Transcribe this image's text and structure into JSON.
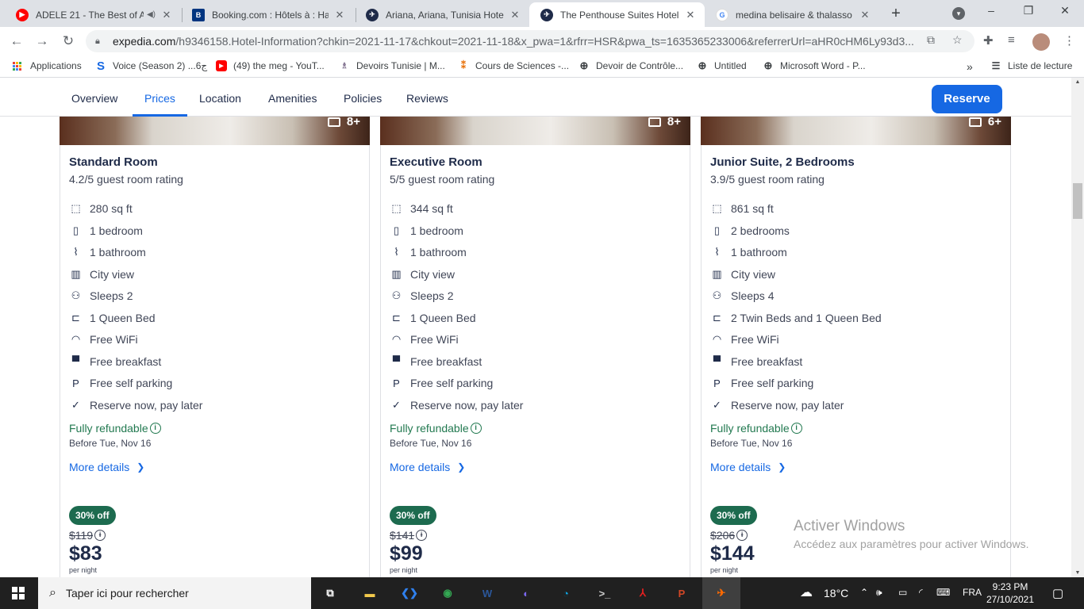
{
  "browser": {
    "tabs": [
      {
        "title": "ADELE 21 - The Best of A",
        "icon": "youtube-icon",
        "color": "#ff0000",
        "media": true
      },
      {
        "title": "Booking.com : Hôtels à : Ham",
        "icon": "booking-icon",
        "color": "#003580",
        "glyph": "B"
      },
      {
        "title": "Ariana, Ariana, Tunisia Hotel S",
        "icon": "expedia-icon",
        "color": "#1f2b49"
      },
      {
        "title": "The Penthouse Suites Hotel",
        "icon": "expedia-icon",
        "color": "#1f2b49",
        "active": true
      },
      {
        "title": "medina belisaire & thalasso -",
        "icon": "google-icon",
        "color": "#4285f4",
        "glyph": "G"
      }
    ],
    "new_tab": "+",
    "url_host": "expedia.com",
    "url_path": "/h9346158.Hotel-Information?chkin=2021-11-17&chkout=2021-11-18&x_pwa=1&rfrr=HSR&pwa_ts=1635365233006&referrerUrl=aHR0cHM6Ly93d3...",
    "bookmarks": [
      {
        "label": "Applications",
        "icon": "apps-grid-icon"
      },
      {
        "label": "Voice (Season 2) ...6ج",
        "icon": "s-icon",
        "color": "#1668e3",
        "glyph": "S"
      },
      {
        "label": "(49) the meg - YouT...",
        "icon": "youtube-icon",
        "color": "#ff0000",
        "glyph": "▶"
      },
      {
        "label": "Devoirs Tunisie | M...",
        "icon": "devoirs-icon",
        "color": "#7b6b8a",
        "glyph": "♗"
      },
      {
        "label": "Cours de Sciences -...",
        "icon": "cours-icon",
        "color": "#e8710a",
        "glyph": "⁑"
      },
      {
        "label": "Devoir de Contrôle...",
        "icon": "globe-icon",
        "color": "#3c4043",
        "glyph": "⊕"
      },
      {
        "label": "Untitled",
        "icon": "globe-icon",
        "color": "#3c4043",
        "glyph": "⊕"
      },
      {
        "label": "Microsoft Word - P...",
        "icon": "globe-icon",
        "color": "#3c4043",
        "glyph": "⊕"
      }
    ],
    "overflow": "»",
    "reading_list": "Liste de lecture"
  },
  "page": {
    "nav": [
      "Overview",
      "Prices",
      "Location",
      "Amenities",
      "Policies",
      "Reviews"
    ],
    "active_nav": "Prices",
    "reserve_label": "Reserve",
    "accent": "#1668e3",
    "rooms": [
      {
        "photo_count": "8+",
        "name": "Standard Room",
        "rating": "4.2/5 guest room rating",
        "features": [
          {
            "icon": "area-icon",
            "text": "280 sq ft"
          },
          {
            "icon": "bedroom-icon",
            "text": "1 bedroom"
          },
          {
            "icon": "shower-icon",
            "text": "1 bathroom"
          },
          {
            "icon": "city-icon",
            "text": "City view"
          },
          {
            "icon": "people-icon",
            "text": "Sleeps 2"
          },
          {
            "icon": "bed-icon",
            "text": "1 Queen Bed"
          },
          {
            "icon": "wifi-icon",
            "text": "Free WiFi"
          },
          {
            "icon": "coffee-icon",
            "text": "Free breakfast"
          },
          {
            "icon": "parking-icon",
            "text": "Free self parking"
          },
          {
            "icon": "check-icon",
            "text": "Reserve now, pay later"
          }
        ],
        "refund": "Fully refundable",
        "refund_before": "Before Tue, Nov 16",
        "more": "More details",
        "discount": "30% off",
        "old_price": "$119",
        "price": "$83",
        "per_night": "per night"
      },
      {
        "photo_count": "8+",
        "name": "Executive Room",
        "rating": "5/5 guest room rating",
        "features": [
          {
            "icon": "area-icon",
            "text": "344 sq ft"
          },
          {
            "icon": "bedroom-icon",
            "text": "1 bedroom"
          },
          {
            "icon": "shower-icon",
            "text": "1 bathroom"
          },
          {
            "icon": "city-icon",
            "text": "City view"
          },
          {
            "icon": "people-icon",
            "text": "Sleeps 2"
          },
          {
            "icon": "bed-icon",
            "text": "1 Queen Bed"
          },
          {
            "icon": "wifi-icon",
            "text": "Free WiFi"
          },
          {
            "icon": "coffee-icon",
            "text": "Free breakfast"
          },
          {
            "icon": "parking-icon",
            "text": "Free self parking"
          },
          {
            "icon": "check-icon",
            "text": "Reserve now, pay later"
          }
        ],
        "refund": "Fully refundable",
        "refund_before": "Before Tue, Nov 16",
        "more": "More details",
        "discount": "30% off",
        "old_price": "$141",
        "price": "$99",
        "per_night": "per night"
      },
      {
        "photo_count": "6+",
        "name": "Junior Suite, 2 Bedrooms",
        "rating": "3.9/5 guest room rating",
        "features": [
          {
            "icon": "area-icon",
            "text": "861 sq ft"
          },
          {
            "icon": "bedroom-icon",
            "text": "2 bedrooms"
          },
          {
            "icon": "shower-icon",
            "text": "1 bathroom"
          },
          {
            "icon": "city-icon",
            "text": "City view"
          },
          {
            "icon": "people-icon",
            "text": "Sleeps 4"
          },
          {
            "icon": "bed-icon",
            "text": "2 Twin Beds and 1 Queen Bed"
          },
          {
            "icon": "wifi-icon",
            "text": "Free WiFi"
          },
          {
            "icon": "coffee-icon",
            "text": "Free breakfast"
          },
          {
            "icon": "parking-icon",
            "text": "Free self parking"
          },
          {
            "icon": "check-icon",
            "text": "Reserve now, pay later"
          }
        ],
        "refund": "Fully refundable",
        "refund_before": "Before Tue, Nov 16",
        "more": "More details",
        "discount": "30% off",
        "old_price": "$206",
        "price": "$144",
        "per_night": "per night"
      }
    ],
    "watermark_title": "Activer Windows",
    "watermark_sub": "Accédez aux paramètres pour activer Windows."
  },
  "taskbar": {
    "search_placeholder": "Taper ici pour rechercher",
    "apps": [
      {
        "icon": "task-view-icon",
        "glyph": "⧉",
        "color": "#ffffff"
      },
      {
        "icon": "file-explorer-icon",
        "glyph": "▬",
        "color": "#f2c94c"
      },
      {
        "icon": "vscode-icon",
        "glyph": "❮❯",
        "color": "#2f80ed"
      },
      {
        "icon": "chrome-icon",
        "glyph": "◉",
        "color": "#34a853"
      },
      {
        "icon": "word-icon",
        "glyph": "W",
        "color": "#2b579a"
      },
      {
        "icon": "eclipse-icon",
        "glyph": "◐",
        "color": "#7b68ee"
      },
      {
        "icon": "edge-icon",
        "glyph": "◔",
        "color": "#0fa3e0"
      },
      {
        "icon": "terminal-icon",
        "glyph": ">_",
        "color": "#cccccc"
      },
      {
        "icon": "acrobat-icon",
        "glyph": "⅄",
        "color": "#e02020"
      },
      {
        "icon": "powerpoint-icon",
        "glyph": "P",
        "color": "#d24726"
      },
      {
        "icon": "expedia-app-icon",
        "glyph": "✈",
        "color": "#ff6a00"
      }
    ],
    "weather": "18°C",
    "language": "FRA",
    "time": "9:23 PM",
    "date": "27/10/2021"
  }
}
